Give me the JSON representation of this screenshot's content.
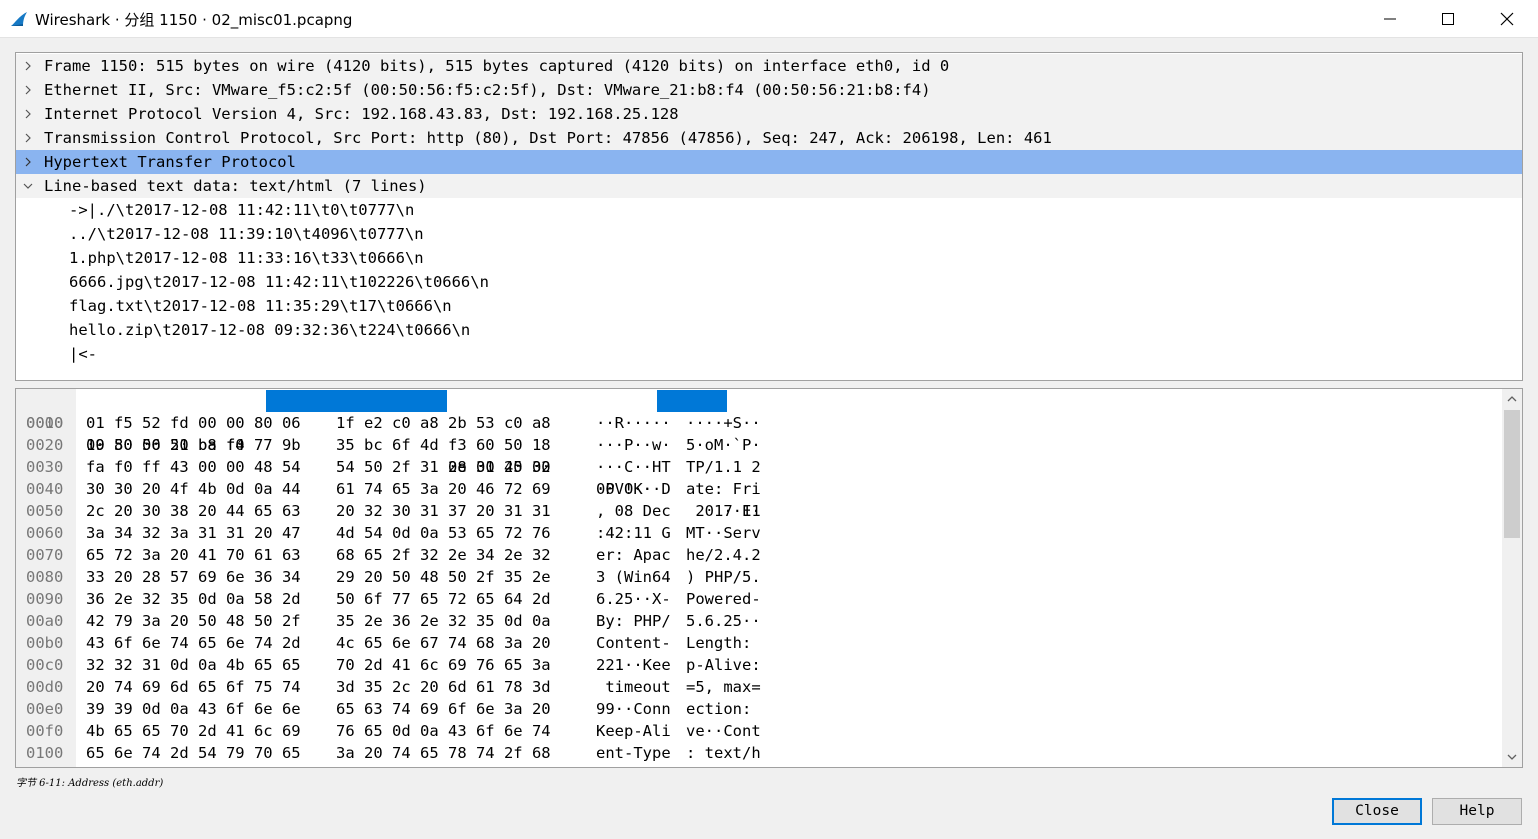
{
  "window": {
    "title": "Wireshark · 分组 1150 · 02_misc01.pcapng"
  },
  "tree": {
    "rows": [
      {
        "text": "Frame 1150: 515 bytes on wire (4120 bits), 515 bytes captured (4120 bits) on interface eth0, id 0",
        "expanded": false
      },
      {
        "text": "Ethernet II, Src: VMware_f5:c2:5f (00:50:56:f5:c2:5f), Dst: VMware_21:b8:f4 (00:50:56:21:b8:f4)",
        "expanded": false
      },
      {
        "text": "Internet Protocol Version 4, Src: 192.168.43.83, Dst: 192.168.25.128",
        "expanded": false
      },
      {
        "text": "Transmission Control Protocol, Src Port: http (80), Dst Port: 47856 (47856), Seq: 247, Ack: 206198, Len: 461",
        "expanded": false
      },
      {
        "text": "Hypertext Transfer Protocol",
        "expanded": false,
        "selected": true
      },
      {
        "text": "Line-based text data: text/html (7 lines)",
        "expanded": true
      }
    ],
    "children": [
      "->|./\\t2017-12-08 11:42:11\\t0\\t0777\\n",
      "../\\t2017-12-08 11:39:10\\t4096\\t0777\\n",
      "1.php\\t2017-12-08 11:33:16\\t33\\t0666\\n",
      "6666.jpg\\t2017-12-08 11:42:11\\t102226\\t0666\\n",
      "flag.txt\\t2017-12-08 11:35:29\\t17\\t0666\\n",
      "hello.zip\\t2017-12-08 09:32:36\\t224\\t0666\\n",
      "|<-"
    ]
  },
  "hex": {
    "rows": [
      {
        "offset": "0000",
        "b1": "00 50 56 21 b8 f4 00 50",
        "b2": "56 f5 c2 5f 08 00 45 00",
        "a1": "·PV!···P",
        "a2": "V··_··E·"
      },
      {
        "offset": "0010",
        "b1": "01 f5 52 fd 00 00 80 06",
        "b2": "1f e2 c0 a8 2b 53 c0 a8",
        "a1": "··R·····",
        "a2": "····+S··"
      },
      {
        "offset": "0020",
        "b1": "19 80 00 50 ba f0 77 9b",
        "b2": "35 bc 6f 4d f3 60 50 18",
        "a1": "···P··w·",
        "a2": "5·oM·`P·"
      },
      {
        "offset": "0030",
        "b1": "fa f0 ff 43 00 00 48 54",
        "b2": "54 50 2f 31 2e 31 20 32",
        "a1": "···C··HT",
        "a2": "TP/1.1 2"
      },
      {
        "offset": "0040",
        "b1": "30 30 20 4f 4b 0d 0a 44",
        "b2": "61 74 65 3a 20 46 72 69",
        "a1": "00 OK··D",
        "a2": "ate: Fri"
      },
      {
        "offset": "0050",
        "b1": "2c 20 30 38 20 44 65 63",
        "b2": "20 32 30 31 37 20 31 31",
        "a1": ", 08 Dec",
        "a2": " 2017 11"
      },
      {
        "offset": "0060",
        "b1": "3a 34 32 3a 31 31 20 47",
        "b2": "4d 54 0d 0a 53 65 72 76",
        "a1": ":42:11 G",
        "a2": "MT··Serv"
      },
      {
        "offset": "0070",
        "b1": "65 72 3a 20 41 70 61 63",
        "b2": "68 65 2f 32 2e 34 2e 32",
        "a1": "er: Apac",
        "a2": "he/2.4.2"
      },
      {
        "offset": "0080",
        "b1": "33 20 28 57 69 6e 36 34",
        "b2": "29 20 50 48 50 2f 35 2e",
        "a1": "3 (Win64",
        "a2": ") PHP/5."
      },
      {
        "offset": "0090",
        "b1": "36 2e 32 35 0d 0a 58 2d",
        "b2": "50 6f 77 65 72 65 64 2d",
        "a1": "6.25··X-",
        "a2": "Powered-"
      },
      {
        "offset": "00a0",
        "b1": "42 79 3a 20 50 48 50 2f",
        "b2": "35 2e 36 2e 32 35 0d 0a",
        "a1": "By: PHP/",
        "a2": "5.6.25··"
      },
      {
        "offset": "00b0",
        "b1": "43 6f 6e 74 65 6e 74 2d",
        "b2": "4c 65 6e 67 74 68 3a 20",
        "a1": "Content-",
        "a2": "Length: "
      },
      {
        "offset": "00c0",
        "b1": "32 32 31 0d 0a 4b 65 65",
        "b2": "70 2d 41 6c 69 76 65 3a",
        "a1": "221··Kee",
        "a2": "p-Alive:"
      },
      {
        "offset": "00d0",
        "b1": "20 74 69 6d 65 6f 75 74",
        "b2": "3d 35 2c 20 6d 61 78 3d",
        "a1": " timeout",
        "a2": "=5, max="
      },
      {
        "offset": "00e0",
        "b1": "39 39 0d 0a 43 6f 6e 6e",
        "b2": "65 63 74 69 6f 6e 3a 20",
        "a1": "99··Conn",
        "a2": "ection: "
      },
      {
        "offset": "00f0",
        "b1": "4b 65 65 70 2d 41 6c 69",
        "b2": "76 65 0d 0a 43 6f 6e 74",
        "a1": "Keep-Ali",
        "a2": "ve··Cont"
      },
      {
        "offset": "0100",
        "b1": "65 6e 74 2d 54 79 70 65",
        "b2": "3a 20 74 65 78 74 2f 68",
        "a1": "ent-Type",
        "a2": ": text/h"
      }
    ]
  },
  "status": {
    "text": "字节 6-11: Address (eth.addr)"
  },
  "buttons": {
    "close": "Close",
    "help": "Help"
  },
  "colors": {
    "selection": "#0078d7",
    "tree_selected": "#8ab4f0"
  }
}
